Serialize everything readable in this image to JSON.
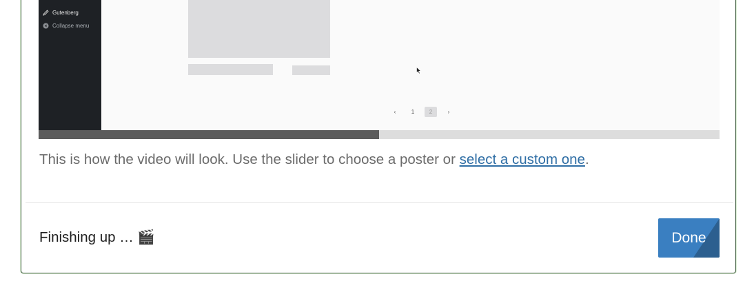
{
  "preview": {
    "sidebar": {
      "items": [
        {
          "label": "Gutenberg",
          "icon": "pencil-icon"
        },
        {
          "label": "Collapse menu",
          "icon": "collapse-circle-icon"
        }
      ]
    },
    "pagination": {
      "prev": "‹",
      "pages": [
        "1",
        "2"
      ],
      "current": "2",
      "next": "›"
    }
  },
  "slider": {
    "progress": 0.5
  },
  "caption": {
    "text_before": "This is how the video will look. Use the slider to choose a poster or ",
    "link": "select a custom one",
    "text_after": "."
  },
  "footer": {
    "status": "Finishing up … 🎬",
    "done_label": "Done"
  },
  "colors": {
    "accent": "#3a7fc1",
    "link": "#2f6ea5",
    "sidebar": "#1e2125",
    "slider_track": "#dddddd",
    "slider_fill": "#5b5b5b"
  }
}
